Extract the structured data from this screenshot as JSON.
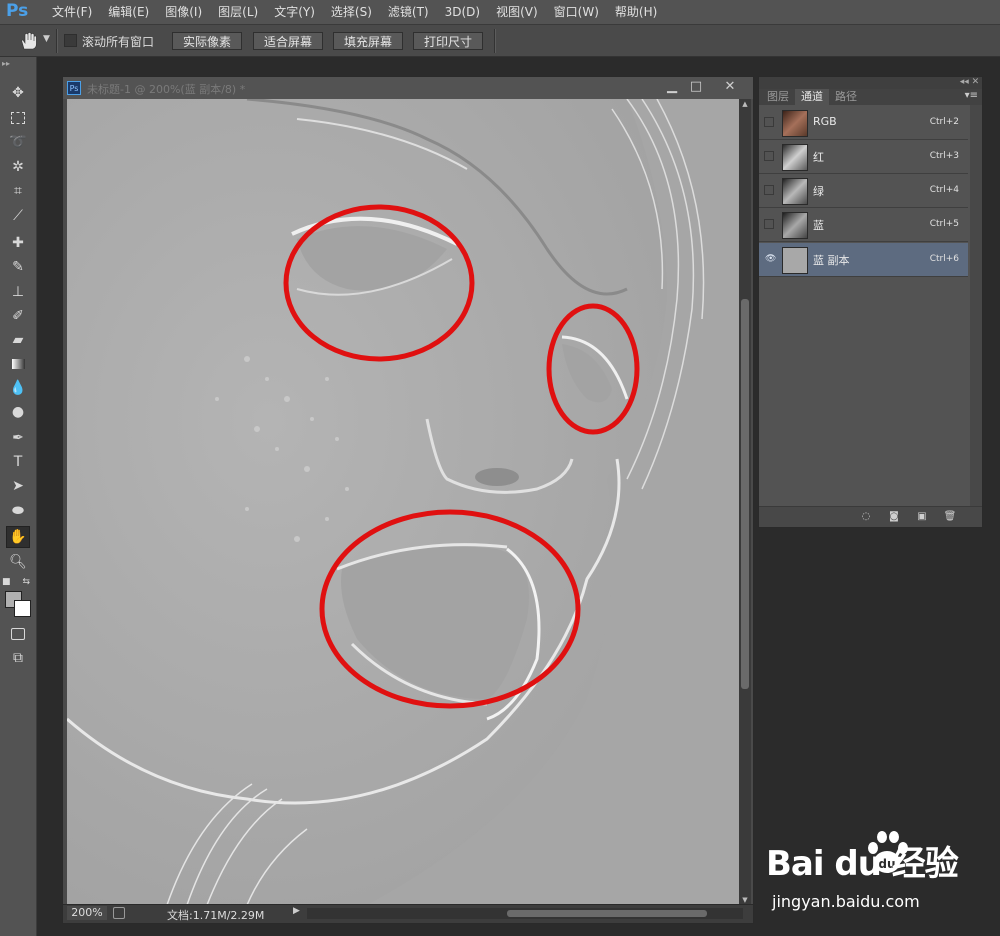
{
  "app": {
    "logo": "Ps"
  },
  "menu": [
    "文件(F)",
    "编辑(E)",
    "图像(I)",
    "图层(L)",
    "文字(Y)",
    "选择(S)",
    "滤镜(T)",
    "3D(D)",
    "视图(V)",
    "窗口(W)",
    "帮助(H)"
  ],
  "options": {
    "scroll_all_label": "滚动所有窗口",
    "scroll_all_checked": false,
    "btn_actual_pixels": "实际像素",
    "btn_fit_screen": "适合屏幕",
    "btn_fill_screen": "填充屏幕",
    "btn_print_size": "打印尺寸"
  },
  "toolbar": {
    "tools": [
      "move-tool",
      "marquee-tool",
      "lasso-tool",
      "magic-wand-tool",
      "crop-tool",
      "eyedropper-tool",
      "spot-healing-tool",
      "brush-tool",
      "clone-stamp-tool",
      "history-brush-tool",
      "eraser-tool",
      "gradient-tool",
      "blur-tool",
      "dodge-tool",
      "pen-tool",
      "type-tool",
      "path-selection-tool",
      "ellipse-tool",
      "hand-tool",
      "zoom-tool"
    ],
    "active_tool": "hand-tool",
    "foreground_color": "#b0b0b0",
    "background_color": "#ffffff"
  },
  "document": {
    "title": "未标题-1 @ 200%(蓝 副本/8) *",
    "zoom": "200%",
    "doc_info": "文档:1.71M/2.29M"
  },
  "channels_panel": {
    "tabs": [
      "图层",
      "通道",
      "路径"
    ],
    "active_tab": "通道",
    "channels": [
      {
        "name": "RGB",
        "shortcut": "Ctrl+2",
        "visible": false,
        "selected": false
      },
      {
        "name": "红",
        "shortcut": "Ctrl+3",
        "visible": false,
        "selected": false
      },
      {
        "name": "绿",
        "shortcut": "Ctrl+4",
        "visible": false,
        "selected": false
      },
      {
        "name": "蓝",
        "shortcut": "Ctrl+5",
        "visible": false,
        "selected": false
      },
      {
        "name": "蓝 副本",
        "shortcut": "Ctrl+6",
        "visible": true,
        "selected": true
      }
    ]
  },
  "annotations": {
    "circle_color": "#e01010"
  },
  "watermark": {
    "logo": "Bai  du 经验",
    "url": "jingyan.baidu.com"
  }
}
